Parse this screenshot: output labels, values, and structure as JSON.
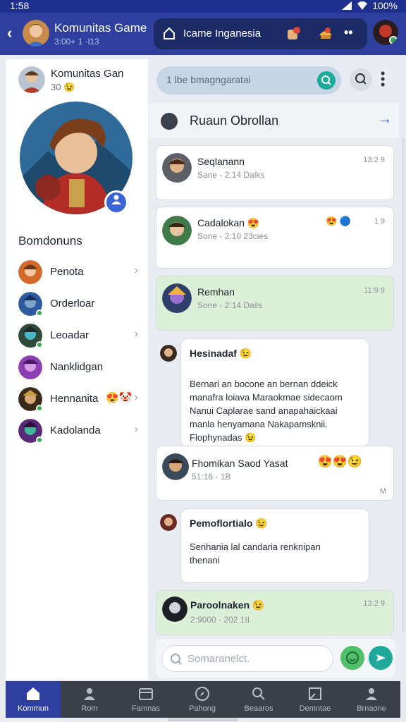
{
  "status_bar": {
    "time": "1:58",
    "battery": "100%"
  },
  "header": {
    "title": "Komunitas Game",
    "subtitle": "3:00+ 1 ·l13",
    "channel_label": "Icame Inganesia"
  },
  "profile": {
    "name": "Komunitas Gan",
    "status": "30 😉"
  },
  "members": {
    "heading": "Bomdonuns",
    "items": [
      {
        "name": "Penota"
      },
      {
        "name": "Orderloar"
      },
      {
        "name": "Leoadar"
      },
      {
        "name": "Nanklidgan"
      },
      {
        "name": "Hennanita",
        "emoji": "😍🤡"
      },
      {
        "name": "Kadolanda"
      }
    ]
  },
  "search": {
    "placeholder": "1 lbe bmagngaratai"
  },
  "room": {
    "title": "Ruaun Obrollan"
  },
  "chats": [
    {
      "name": "Seqlanann",
      "sub": "Sane - 2:14 Dalks",
      "time": "13:2 9"
    },
    {
      "name": "Cadalokan 😍",
      "sub": "Sone - 2:10 23cies",
      "time": "1 9",
      "badges": "😍 🔵"
    },
    {
      "name": "Remhan",
      "sub": "Sone - 2:14 Dails",
      "time": "11:9 9"
    }
  ],
  "messages": [
    {
      "name": "Hesinadaf 😉",
      "text": [
        "Bernari an bocone an bernan ddeick",
        "manafra loiava Maraokmae sidecaom",
        "Nanui Caplarae sand anapahaickaai",
        "manla henyamana Nakapamsknii.",
        "Flophynadas 😉"
      ]
    },
    {
      "name": "Fhomikan Saod Yasat",
      "sub": "51:16 - 1B",
      "emoji": "😍😍😉",
      "side": "M"
    },
    {
      "name": "Pemoflortialo 😉",
      "text": [
        "Senhania lal candaria renknipan",
        "thenani"
      ]
    },
    {
      "name": "Paroolnaken 😉",
      "sub": "2:9000 - 202 1II",
      "time": "13:2 9"
    }
  ],
  "composer": {
    "placeholder": "Somaranelct."
  },
  "nav": [
    {
      "label": "Kommun",
      "icon": "home-icon",
      "active": true
    },
    {
      "label": "Rom",
      "icon": "people-icon"
    },
    {
      "label": "Famnas",
      "icon": "folder-icon"
    },
    {
      "label": "Pahong",
      "icon": "compass-icon"
    },
    {
      "label": "Beaaros",
      "icon": "search-icon"
    },
    {
      "label": "Demntae",
      "icon": "edit-icon"
    },
    {
      "label": "Brnaone",
      "icon": "profile-icon"
    }
  ],
  "colors": {
    "header": "#2f3f9f",
    "accent": "#1ea99a",
    "green_card": "#dcefd7"
  }
}
